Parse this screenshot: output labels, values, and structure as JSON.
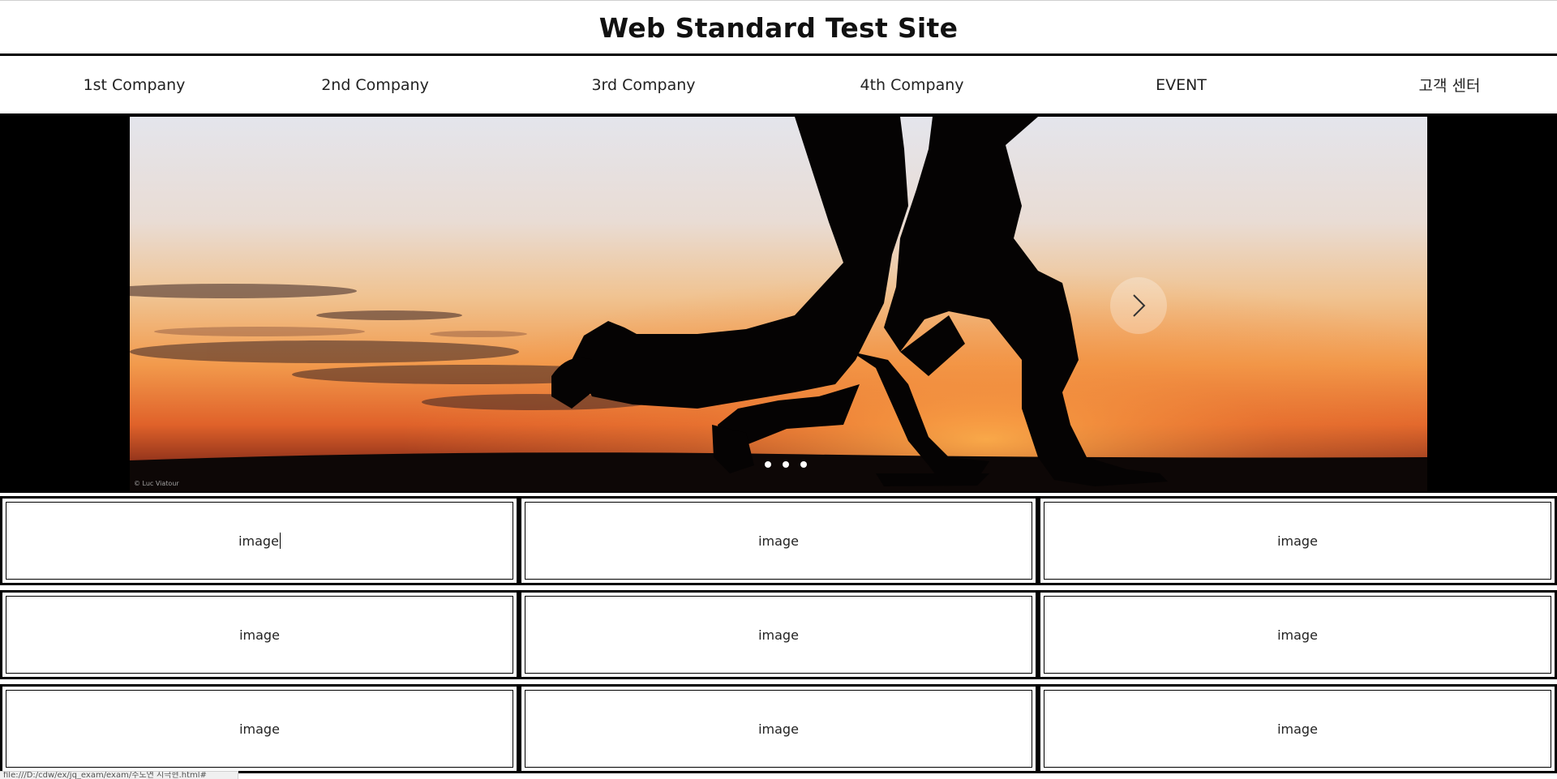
{
  "header": {
    "title": "Web Standard Test Site"
  },
  "nav": {
    "items": [
      {
        "label": "1st Company"
      },
      {
        "label": "2nd Company"
      },
      {
        "label": "3rd Company"
      },
      {
        "label": "4th Company"
      },
      {
        "label": "EVENT"
      },
      {
        "label": "고객 센터"
      }
    ]
  },
  "hero": {
    "photo_credit": "© Luc Viatour",
    "next_icon": "chevron-right-icon",
    "dot_count": 3
  },
  "grid": {
    "cells": [
      {
        "label": "image"
      },
      {
        "label": "image"
      },
      {
        "label": "image"
      },
      {
        "label": "image"
      },
      {
        "label": "image"
      },
      {
        "label": "image"
      },
      {
        "label": "image"
      },
      {
        "label": "image"
      },
      {
        "label": "image"
      }
    ]
  },
  "status_bar": {
    "text": "file:///D:/cdw/ex/jq_exam/exam/주도연 시극현.html#"
  },
  "colors": {
    "background": "#ffffff",
    "border": "#000000",
    "hero_background": "#000000",
    "sky_top": "#e8e9ef",
    "sunset_orange": "#f28a3a"
  }
}
